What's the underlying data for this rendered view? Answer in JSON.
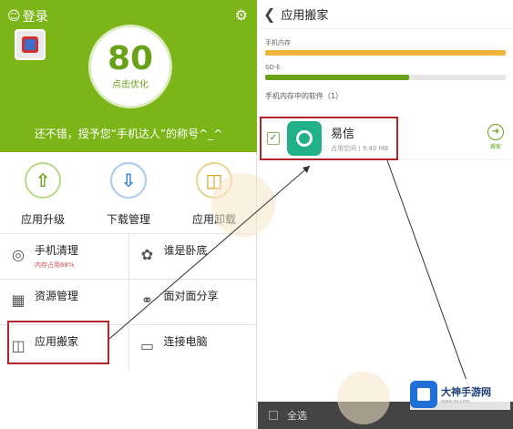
{
  "left": {
    "login": "登录",
    "score": "80",
    "score_action": "点击优化",
    "praise": "还不错，授予您“手机达人”的称号^_^",
    "tools": [
      {
        "label": "应用升级",
        "icon": "upload-arrow-icon",
        "color": "#6aa11a"
      },
      {
        "label": "下载管理",
        "icon": "download-arrow-icon",
        "color": "#2f7fd8"
      },
      {
        "label": "应用卸载",
        "icon": "trash-icon",
        "color": "#d7a41c"
      }
    ],
    "grid": [
      [
        {
          "title": "手机清理",
          "sub": "内存占用68%",
          "icon": "speedometer-icon",
          "warn": true
        },
        {
          "title": "谁是卧底",
          "sub": "",
          "icon": "mask-icon",
          "warn": false
        }
      ],
      [
        {
          "title": "资源管理",
          "sub": "",
          "icon": "grid-icon",
          "warn": false
        },
        {
          "title": "面对面分享",
          "sub": "",
          "icon": "share-icon",
          "warn": false
        }
      ],
      [
        {
          "title": "应用搬家",
          "sub": "",
          "icon": "phone-move-icon",
          "warn": false
        },
        {
          "title": "连接电脑",
          "sub": "",
          "icon": "monitor-icon",
          "warn": false
        }
      ]
    ]
  },
  "right": {
    "title": "应用搬家",
    "phone_storage_label": "手机内存",
    "phone_storage_fraction": 1.0,
    "sd_label": "SD卡",
    "sd_fraction": 0.6,
    "section_label": "手机内存中的软件（1）",
    "app": {
      "name": "易信",
      "meta": "占用空间 | 9.40 MB",
      "checked": true
    },
    "move_label": "搬家",
    "select_all": "全选"
  },
  "watermark": {
    "name": "大神手游网",
    "url": "www.ds.com"
  },
  "colors": {
    "green": "#7cb518",
    "highlight": "#b0262a",
    "storage_bar": "#f0b43a",
    "sd_bar": "#6aa11a"
  }
}
